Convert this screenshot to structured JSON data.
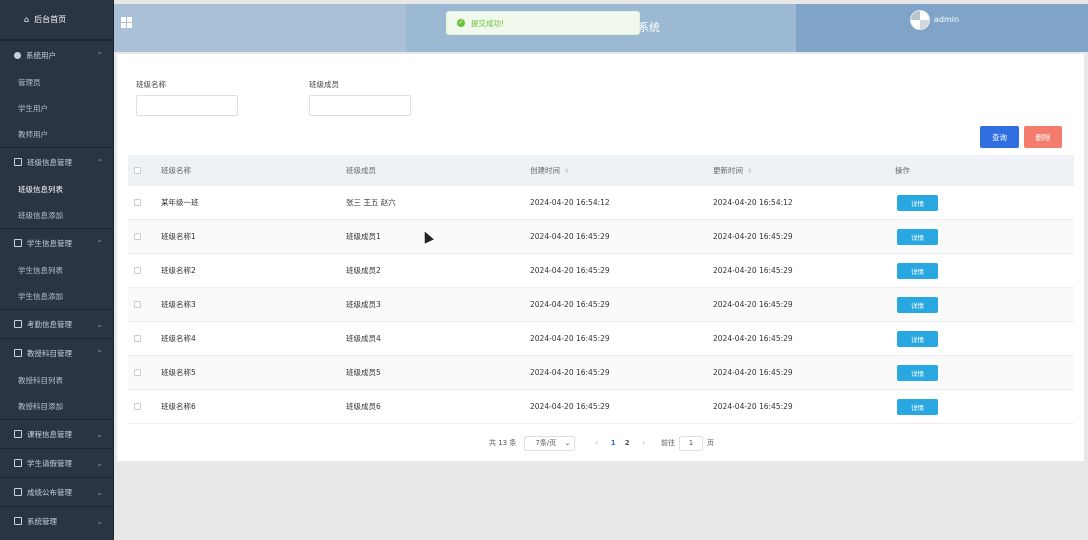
{
  "sidebar": {
    "home": "后台首页",
    "groups": [
      {
        "label": "系统用户",
        "items": [
          "管理员",
          "学生用户",
          "教师用户"
        ]
      },
      {
        "label": "班级信息管理",
        "items": [
          "班级信息列表",
          "班级信息添加"
        ]
      },
      {
        "label": "学生信息管理",
        "items": [
          "学生信息列表",
          "学生信息添加"
        ]
      },
      {
        "label": "考勤信息管理",
        "items": []
      },
      {
        "label": "教授科目管理",
        "items": [
          "教授科目列表",
          "教授科目添加"
        ]
      },
      {
        "label": "课程信息管理",
        "items": []
      },
      {
        "label": "学生请假管理",
        "items": []
      },
      {
        "label": "成绩公布管理",
        "items": []
      },
      {
        "label": "系统管理",
        "items": []
      }
    ]
  },
  "header": {
    "title_fragment": "系统",
    "user": "admin"
  },
  "toast": {
    "message": "提交成功!"
  },
  "filters": {
    "class_name_label": "班级名称",
    "class_name_value": "",
    "class_members_label": "班级成员",
    "class_members_value": ""
  },
  "actions": {
    "query": "查询",
    "delete": "删除"
  },
  "table": {
    "headers": [
      "班级名称",
      "班级成员",
      "创建时间",
      "更新时间",
      "操作"
    ],
    "detail_label": "详情",
    "rows": [
      {
        "name": "某年级一班",
        "members": "张三 王五 赵六",
        "created": "2024-04-20 16:54:12",
        "updated": "2024-04-20 16:54:12"
      },
      {
        "name": "班级名称1",
        "members": "班级成员1",
        "created": "2024-04-20 16:45:29",
        "updated": "2024-04-20 16:45:29"
      },
      {
        "name": "班级名称2",
        "members": "班级成员2",
        "created": "2024-04-20 16:45:29",
        "updated": "2024-04-20 16:45:29"
      },
      {
        "name": "班级名称3",
        "members": "班级成员3",
        "created": "2024-04-20 16:45:29",
        "updated": "2024-04-20 16:45:29"
      },
      {
        "name": "班级名称4",
        "members": "班级成员4",
        "created": "2024-04-20 16:45:29",
        "updated": "2024-04-20 16:45:29"
      },
      {
        "name": "班级名称5",
        "members": "班级成员5",
        "created": "2024-04-20 16:45:29",
        "updated": "2024-04-20 16:45:29"
      },
      {
        "name": "班级名称6",
        "members": "班级成员6",
        "created": "2024-04-20 16:45:29",
        "updated": "2024-04-20 16:45:29"
      }
    ]
  },
  "pagination": {
    "total": "共 13 条",
    "page_size": "7条/页",
    "pages": [
      "1",
      "2"
    ],
    "current": "1",
    "goto_label": "前往",
    "goto_value": "1",
    "page_suffix": "页"
  },
  "colors": {
    "accent": "#2f6fe0",
    "danger": "#f47c6c",
    "detail": "#29a7e0",
    "sidebar_bg": "#2a3544",
    "success": "#67c23a"
  }
}
